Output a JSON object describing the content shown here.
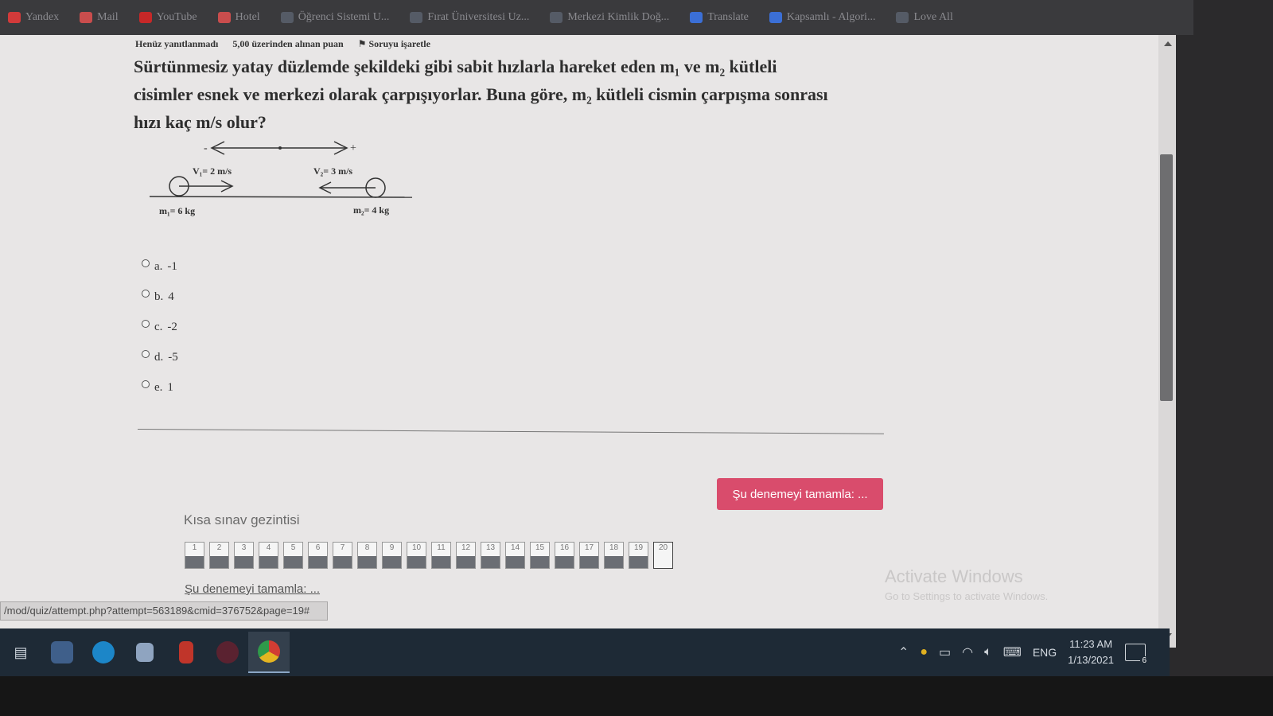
{
  "bookmarks": [
    {
      "label": "Yandex",
      "icon": "yandex-icon",
      "color": "#d23a3a"
    },
    {
      "label": "Mail",
      "icon": "mail-icon",
      "color": "#c94d4d"
    },
    {
      "label": "YouTube",
      "icon": "youtube-icon",
      "color": "#c62828"
    },
    {
      "label": "Hotel",
      "icon": "hotel-icon",
      "color": "#c94d4d"
    },
    {
      "label": "Öğrenci Sistemi U...",
      "icon": "student-icon",
      "color": "#555b66"
    },
    {
      "label": "Fırat Üniversitesi Uz...",
      "icon": "university-icon",
      "color": "#555b66"
    },
    {
      "label": "Merkezi Kimlik Doğ...",
      "icon": "identity-icon",
      "color": "#555b66"
    },
    {
      "label": "Translate",
      "icon": "translate-icon",
      "color": "#3b6fd6"
    },
    {
      "label": "Kapsamlı - Algori...",
      "icon": "word-icon",
      "color": "#3b6fd6"
    },
    {
      "label": "Love All",
      "icon": "bookmark-icon",
      "color": "#555b66"
    }
  ],
  "question_info": {
    "status": "Henüz yanıtlanmadı",
    "points": "5,00 üzerinden alınan puan",
    "flag": "Soruyu işaretle"
  },
  "question": {
    "line1": "Sürtünmesiz yatay düzlemde şekildeki gibi sabit hızlarla hareket eden m₁ ve m₂ kütleli",
    "line2": "cisimler esnek ve merkezi olarak çarpışıyorlar. Buna göre, m₂ kütleli cismin çarpışma sonrası",
    "line3": "hızı kaç m/s olur?"
  },
  "diagram": {
    "minus": "-",
    "plus": "+",
    "v1_label": "V₁= 2 m/s",
    "v2_label": "V₂= 3 m/s",
    "m1_label": "m₁= 6 kg",
    "m2_label": "m₂= 4 kg"
  },
  "options": [
    {
      "letter": "a.",
      "value": "-1"
    },
    {
      "letter": "b.",
      "value": "4"
    },
    {
      "letter": "c.",
      "value": "-2"
    },
    {
      "letter": "d.",
      "value": "-5"
    },
    {
      "letter": "e.",
      "value": "1"
    }
  ],
  "finish_button": "Şu denemeyi tamamla: ...",
  "navigation": {
    "title": "Kısa sınav gezintisi",
    "cells": [
      "1",
      "2",
      "3",
      "4",
      "5",
      "6",
      "7",
      "8",
      "9",
      "10",
      "11",
      "12",
      "13",
      "14",
      "15",
      "16",
      "17",
      "18",
      "19",
      "20"
    ],
    "current": "20",
    "finish_link": "Şu denemeyi tamamla: ..."
  },
  "activate_windows": {
    "title": "Activate Windows",
    "subtitle": "Go to Settings to activate Windows."
  },
  "status_url": "/mod/quiz/attempt.php?attempt=563189&cmid=376752&page=19#",
  "taskbar": {
    "icons": [
      "task-view-icon",
      "file-explorer-icon",
      "edge-icon",
      "store-icon",
      "office-icon",
      "app-icon",
      "chrome-icon"
    ],
    "language": "ENG",
    "time": "11:23 AM",
    "date": "1/13/2021",
    "notifications": "6"
  }
}
